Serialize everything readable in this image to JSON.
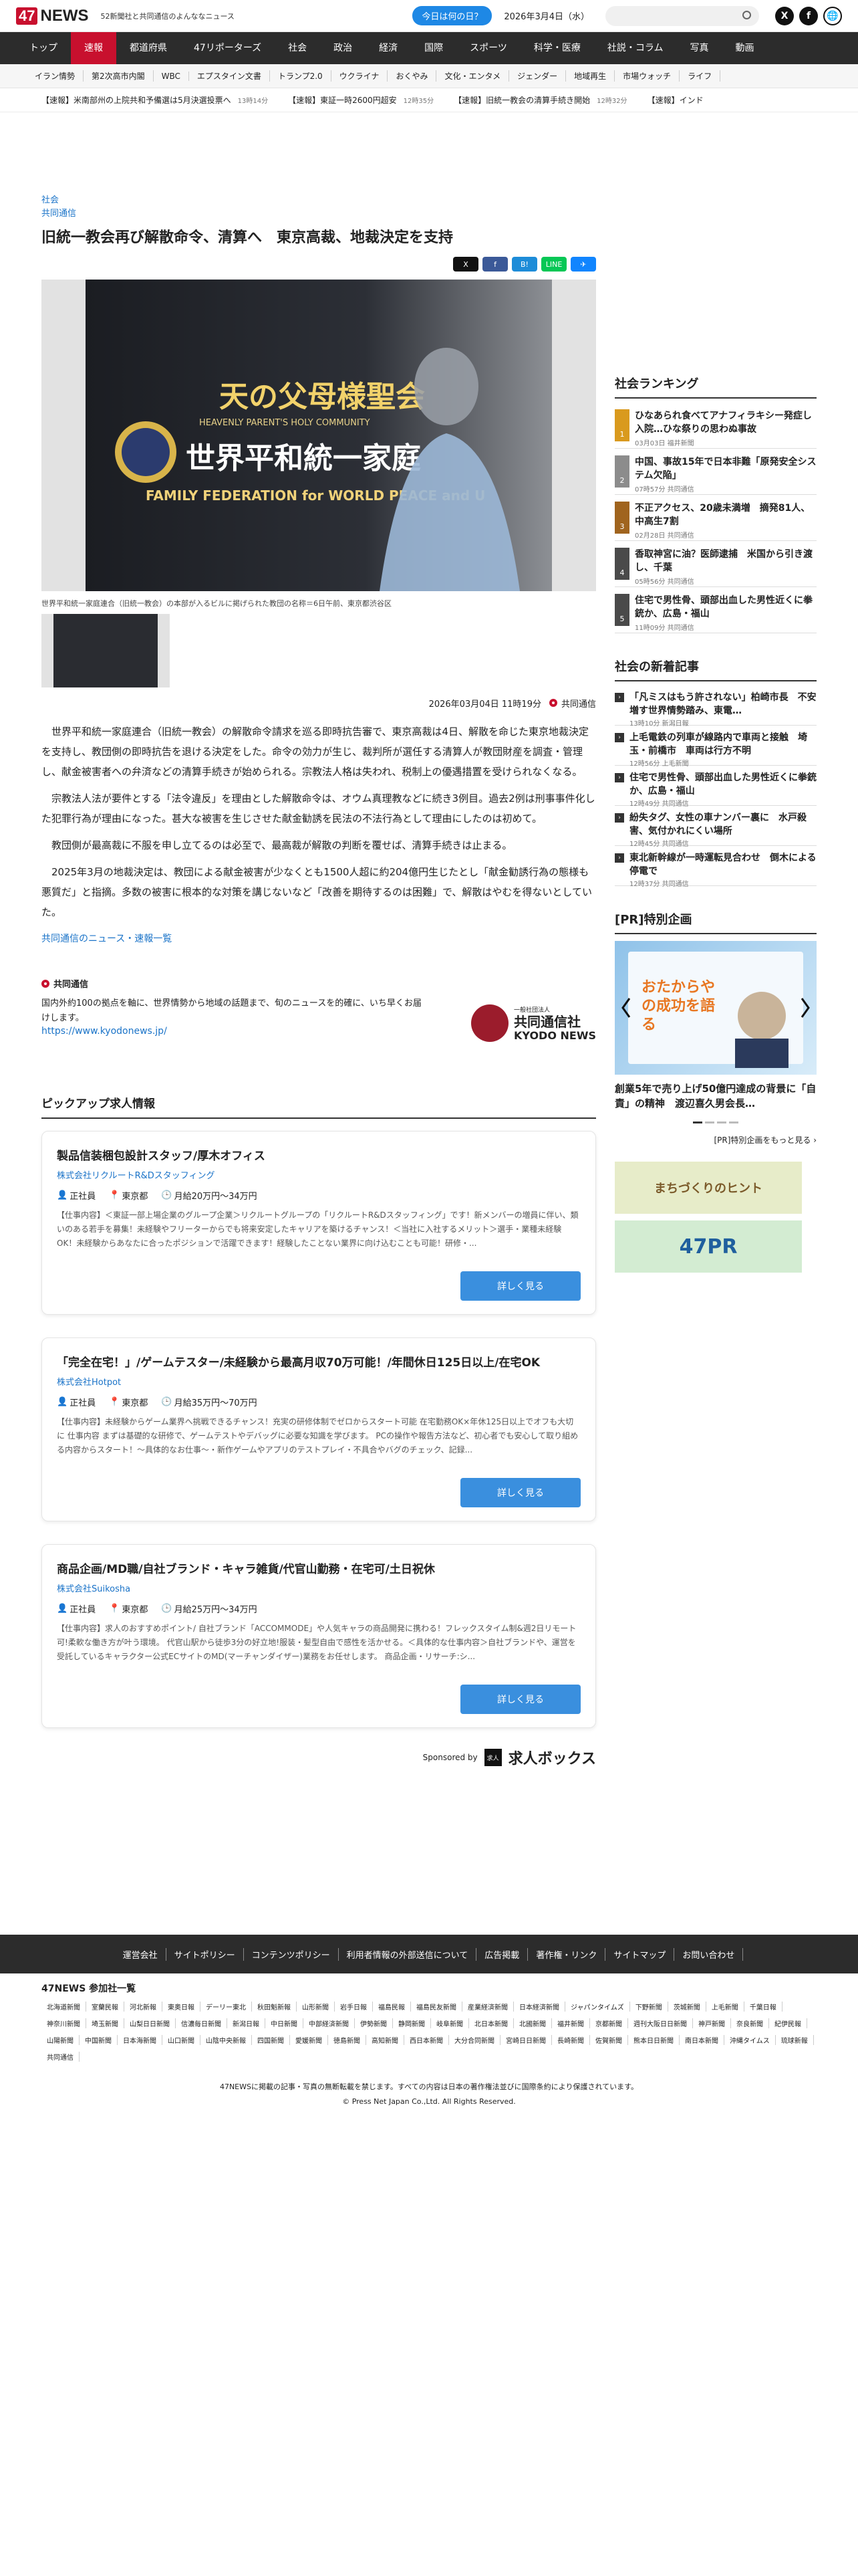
{
  "header": {
    "logo": "47NEWS",
    "tagline": "52新聞社と共同通信のよんななニュース",
    "today_button": "今日は何の日？",
    "date": "2026年3月4日（水）",
    "social": [
      "X",
      "f",
      "🌐"
    ]
  },
  "main_nav": [
    "トップ",
    "速報",
    "都道府県",
    "47リポーターズ",
    "社会",
    "政治",
    "経済",
    "国際",
    "スポーツ",
    "科学・医療",
    "社説・コラム",
    "写真",
    "動画"
  ],
  "sub_nav": [
    "イラン情勢",
    "第2次高市内閣",
    "WBC",
    "エプスタイン文書",
    "トランプ2.0",
    "ウクライナ",
    "おくやみ",
    "文化・エンタメ",
    "ジェンダー",
    "地域再生",
    "市場ウォッチ",
    "ライフ"
  ],
  "ticker": [
    {
      "text": "【速報】米南部州の上院共和予備選は5月決選投票へ",
      "time": "13時14分"
    },
    {
      "text": "【速報】東証一時2600円超安",
      "time": "12時35分"
    },
    {
      "text": "【速報】旧統一教会の清算手続き開始",
      "time": "12時32分"
    },
    {
      "text": "【速報】インド",
      "time": ""
    }
  ],
  "article": {
    "category": "社会",
    "agency": "共同通信",
    "title": "旧統一教会再び解散命令、清算へ　東京高裁、地裁決定を支持",
    "share": [
      "X",
      "f",
      "B!",
      "LINE",
      "✈"
    ],
    "photo_caption": "世界平和統一家庭連合（旧統一教会）の本部が入るビルに掲げられた教団の名称＝6日午前、東京都渋谷区",
    "photo_sign_line1": "天の父母様聖会",
    "photo_sign_line2": "HEAVENLY PARENT'S HOLY COMMUNITY",
    "photo_sign_line3": "世界平和統一家庭",
    "photo_sign_line4": "FAMILY FEDERATION for WORLD PEACE and U",
    "datetime": "2026年03月04日 11時19分",
    "byline": "共同通信",
    "paragraphs": [
      "世界平和統一家庭連合（旧統一教会）の解散命令請求を巡る即時抗告審で、東京高裁は4日、解散を命じた東京地裁決定を支持し、教団側の即時抗告を退ける決定をした。命令の効力が生じ、裁判所が選任する清算人が教団財産を調査・管理し、献金被害者への弁済などの清算手続きが始められる。宗教法人格は失われ、税制上の優遇措置を受けられなくなる。",
      "宗教法人法が要件とする「法令違反」を理由とした解散命令は、オウム真理教などに続き3例目。過去2例は刑事事件化した犯罪行為が理由になった。甚大な被害を生じさせた献金勧誘を民法の不法行為として理由にしたのは初めて。",
      "教団側が最高裁に不服を申し立てるのは必至で、最高裁が解散の判断を覆せば、清算手続きは止まる。",
      "2025年3月の地裁決定は、教団による献金被害が少なくとも1500人超に約204億円生じたとし「献金勧誘行為の態様も悪質だ」と指摘。多数の被害に根本的な対策を講じないなど「改善を期待するのは困難」で、解散はやむを得ないとしていた。"
    ],
    "more_link": "共同通信のニュース・速報一覧"
  },
  "kyodo": {
    "name": "共同通信",
    "desc": "国内外約100の拠点を軸に、世界情勢から地域の話題まで、旬のニュースを的確に、いち早くお届けします。",
    "url": "https://www.kyodonews.jp/",
    "logo_small": "一般社団法人",
    "logo_jp": "共同通信社",
    "logo_en": "KYODO NEWS"
  },
  "pickup": {
    "heading": "ピックアップ求人情報",
    "jobs": [
      {
        "title": "製品信装梱包設計スタッフ/厚木オフィス",
        "company": "株式会社リクルートR&Dスタッフィング",
        "type": "正社員",
        "location": "東京都",
        "salary": "月給20万円〜34万円",
        "body": "【仕事内容】＜東証一部上場企業のグループ企業＞リクルートグループの「リクルートR&Dスタッフィング」です！新メンバーの増員に伴い、類いのある若手を募集！未経験やフリーターからでも将来安定したキャリアを築けるチャンス！＜当社に入社するメリット＞選手・業種未経験OK！未経験からあなたに合ったポジションで活躍できます！経験したことない業界に向け込むことも可能！研修・..."
      },
      {
        "title": "「完全在宅！」/ゲームテスター/未経験から最高月収70万可能！/年間休日125日以上/在宅OK",
        "company": "株式会社Hotpot",
        "type": "正社員",
        "location": "東京都",
        "salary": "月給35万円〜70万円",
        "body": "【仕事内容】未経験からゲーム業界へ挑戦できるチャンス！充実の研修体制でゼロからスタート可能 在宅勤務OK×年休125日以上でオフも大切に 仕事内容 まずは基礎的な研修で、ゲームテストやデバッグに必要な知識を学びます。 PCの操作や報告方法など、初心者でも安心して取り組める内容からスタート！〜具体的なお仕事〜・新作ゲームやアプリのテストプレイ・不具合やバグのチェック、記録..."
      },
      {
        "title": "商品企画/MD職/自社ブランド・キャラ雑貨/代官山勤務・在宅可/土日祝休",
        "company": "株式会社Suikosha",
        "type": "正社員",
        "location": "東京都",
        "salary": "月給25万円〜34万円",
        "body": "【仕事内容】求人のおすすめポイント/ 自社ブランド「ACCOMMODE」や人気キャラの商品開発に携わる！フレックスタイム制&週2日リモート可!柔軟な働き方が叶う環境。 代官山駅から徒歩3分の好立地!服装・髪型自由で感性を活かせる。＜具体的な仕事内容＞自社ブランドや、運営を受託しているキャラクター公式ECサイトのMD(マーチャンダイザー)業務をお任せします。 商品企画・リサーチ:シ..."
      }
    ],
    "detail_button": "詳しく見る",
    "sponsored_by": "Sponsored by",
    "sponsor_name": "求人ボックス",
    "sponsor_icon": "求人"
  },
  "sidebar": {
    "ranking_title": "社会ランキング",
    "ranking": [
      {
        "rank": "1",
        "title": "ひなあられ食べてアナフィラキシー発症し入院…ひな祭りの思わぬ事故",
        "time": "03月03日",
        "src": "福井新聞",
        "color": "#d99a1e"
      },
      {
        "rank": "2",
        "title": "中国、事故15年で日本非難「原発安全システム欠陥」",
        "time": "07時57分",
        "src": "共同通信",
        "color": "#8c8c8c"
      },
      {
        "rank": "3",
        "title": "不正アクセス、20歳未満増　摘発81人、中高生7割",
        "time": "02月28日",
        "src": "共同通信",
        "color": "#a0641e"
      },
      {
        "rank": "4",
        "title": "香取神宮に油？医師逮捕　米国から引き渡し、千葉",
        "time": "05時56分",
        "src": "共同通信",
        "color": "#4a4a4a"
      },
      {
        "rank": "5",
        "title": "住宅で男性骨、頭部出血した男性近くに拳銃か、広島・福山",
        "time": "11時09分",
        "src": "共同通信",
        "color": "#4a4a4a"
      }
    ],
    "new_title": "社会の新着記事",
    "new_items": [
      {
        "title": "「凡ミスはもう許されない」柏崎市長　不安増す世界情勢踏み、東電…",
        "time": "13時10分",
        "src": "新潟日報"
      },
      {
        "title": "上毛電鉄の列車が線路内で車両と接触　埼玉・前橋市　車両は行方不明",
        "time": "12時56分",
        "src": "上毛新聞"
      },
      {
        "title": "住宅で男性骨、頭部出血した男性近くに拳銃か、広島・福山",
        "time": "12時49分",
        "src": "共同通信"
      },
      {
        "title": "紛失タグ、女性の車ナンバー裏に　水戸殺害、気付かれにくい場所",
        "time": "12時45分",
        "src": "共同通信"
      },
      {
        "title": "東北新幹線が一時運転見合わせ　倒木による停電で",
        "time": "12時37分",
        "src": "共同通信"
      }
    ],
    "pr_title": "[PR]特別企画",
    "pr_image_text": "おたからやの成功を語る",
    "pr_article": "創業5年で売り上げ50億円達成の背景に「自責」の精神　渡辺喜久男会長…",
    "pr_more": "[PR]特別企画をもっと見る ›",
    "banner1": "まちづくりのヒント",
    "banner2": "47PR"
  },
  "footer": {
    "nav": [
      "運営会社",
      "サイトポリシー",
      "コンテンツポリシー",
      "利用者情報の外部送信について",
      "広告掲載",
      "著作権・リンク",
      "サイトマップ",
      "お問い合わせ"
    ],
    "members_title": "47NEWS 参加社一覧",
    "members": [
      "北海道新聞",
      "室蘭民報",
      "河北新報",
      "東奥日報",
      "デーリー東北",
      "秋田魁新報",
      "山形新聞",
      "岩手日報",
      "福島民報",
      "福島民友新聞",
      "産業経済新聞",
      "日本経済新聞",
      "ジャパンタイムズ",
      "下野新聞",
      "茨城新聞",
      "上毛新聞",
      "千葉日報",
      "神奈川新聞",
      "埼玉新聞",
      "山梨日日新聞",
      "信濃毎日新聞",
      "新潟日報",
      "中日新聞",
      "中部経済新聞",
      "伊勢新聞",
      "静岡新聞",
      "岐阜新聞",
      "北日本新聞",
      "北國新聞",
      "福井新聞",
      "京都新聞",
      "週刊大阪日日新聞",
      "神戸新聞",
      "奈良新聞",
      "紀伊民報",
      "山陽新聞",
      "中国新聞",
      "日本海新聞",
      "山口新聞",
      "山陰中央新報",
      "四国新聞",
      "愛媛新聞",
      "徳島新聞",
      "高知新聞",
      "西日本新聞",
      "大分合同新聞",
      "宮崎日日新聞",
      "長崎新聞",
      "佐賀新聞",
      "熊本日日新聞",
      "南日本新聞",
      "沖縄タイムス",
      "琉球新報",
      "共同通信"
    ],
    "copyright1": "47NEWSに掲載の記事・写真の無断転載を禁じます。すべての内容は日本の著作権法並びに国際条約により保護されています。",
    "copyright2": "© Press Net Japan Co.,Ltd. All Rights Reserved."
  }
}
